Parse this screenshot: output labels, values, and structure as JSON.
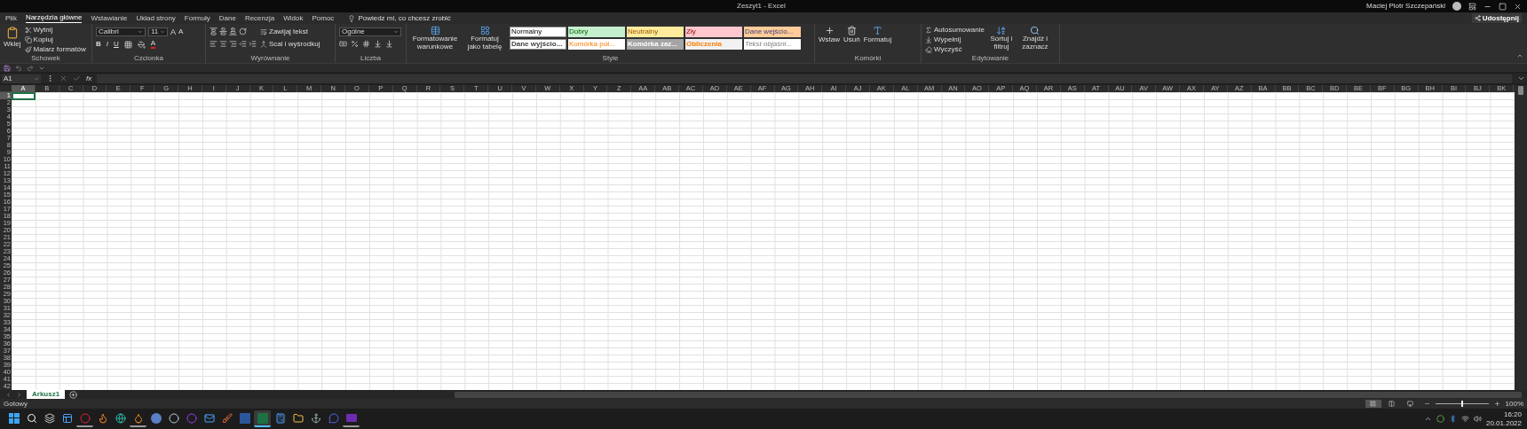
{
  "title_bar": {
    "title": "Zeszyt1 - Excel",
    "user": "Maciej Piotr Szczepański"
  },
  "tabs": [
    {
      "label": "Plik",
      "selected": false
    },
    {
      "label": "Narzędzia główne",
      "selected": true
    },
    {
      "label": "Wstawianie",
      "selected": false
    },
    {
      "label": "Układ strony",
      "selected": false
    },
    {
      "label": "Formuły",
      "selected": false
    },
    {
      "label": "Dane",
      "selected": false
    },
    {
      "label": "Recenzja",
      "selected": false
    },
    {
      "label": "Widok",
      "selected": false
    },
    {
      "label": "Pomoc",
      "selected": false
    }
  ],
  "tell_me": "Powiedz mi, co chcesz zrobić",
  "share_button": "Udostępnij",
  "ribbon": {
    "clipboard": {
      "label": "Schowek",
      "paste": "Wklej",
      "items": [
        "Wytnij",
        "Kopiuj",
        "Malarz formatów"
      ]
    },
    "font": {
      "label": "Czcionka",
      "font_name": "Calibri",
      "font_size": "11",
      "grow": "A",
      "shrink": "A",
      "bold": "B",
      "italic": "I",
      "underline": "U",
      "font_color": "A"
    },
    "alignment": {
      "label": "Wyrównanie",
      "wrap": "Zawijaj tekst",
      "merge": "Scal i wyśrodkuj"
    },
    "number": {
      "label": "Liczba",
      "format": "Ogólne"
    },
    "styles": {
      "label": "Style",
      "conditional": "Formatowanie warunkowe",
      "as_table": "Formatuj jako tabelę",
      "cells": [
        {
          "text": "Normalny",
          "kind": "normal"
        },
        {
          "text": "Dobry",
          "kind": "good"
        },
        {
          "text": "Neutralny",
          "kind": "neutral"
        },
        {
          "text": "Zły",
          "kind": "bad"
        },
        {
          "text": "Dane wejścio...",
          "kind": "input"
        },
        {
          "text": "Dane wyjścio...",
          "kind": "output"
        },
        {
          "text": "Komórka poł...",
          "kind": "linked"
        },
        {
          "text": "Komórka zaz...",
          "kind": "check"
        },
        {
          "text": "Obliczenia",
          "kind": "calculation"
        },
        {
          "text": "Tekst objaśni...",
          "kind": "explanatory"
        }
      ]
    },
    "cells": {
      "label": "Komórki",
      "buttons": [
        "Wstaw",
        "Usuń",
        "Formatuj"
      ]
    },
    "editing": {
      "label": "Edytowanie",
      "autosum": "Autosumowanie",
      "fill": "Wypełnij",
      "clear": "Wyczyść",
      "sort": "Sortuj i filtruj",
      "find": "Znajdź i zaznacz"
    }
  },
  "formula_bar": {
    "name_box": "A1",
    "function_label": "fx"
  },
  "columns": [
    {
      "label": "A",
      "selected": true
    },
    {
      "label": "B",
      "selected": false
    },
    {
      "label": "C",
      "selected": false
    },
    {
      "label": "D",
      "selected": false
    },
    {
      "label": "E",
      "selected": false
    },
    {
      "label": "F",
      "selected": false
    },
    {
      "label": "G",
      "selected": false
    },
    {
      "label": "H",
      "selected": false
    },
    {
      "label": "I",
      "selected": false
    },
    {
      "label": "J",
      "selected": false
    },
    {
      "label": "K",
      "selected": false
    },
    {
      "label": "L",
      "selected": false
    },
    {
      "label": "M",
      "selected": false
    },
    {
      "label": "N",
      "selected": false
    },
    {
      "label": "O",
      "selected": false
    },
    {
      "label": "P",
      "selected": false
    },
    {
      "label": "Q",
      "selected": false
    },
    {
      "label": "R",
      "selected": false
    },
    {
      "label": "S",
      "selected": false
    },
    {
      "label": "T",
      "selected": false
    },
    {
      "label": "U",
      "selected": false
    },
    {
      "label": "V",
      "selected": false
    },
    {
      "label": "W",
      "selected": false
    },
    {
      "label": "X",
      "selected": false
    },
    {
      "label": "Y",
      "selected": false
    },
    {
      "label": "Z",
      "selected": false
    },
    {
      "label": "AA",
      "selected": false
    },
    {
      "label": "AB",
      "selected": false
    },
    {
      "label": "AC",
      "selected": false
    },
    {
      "label": "AD",
      "selected": false
    },
    {
      "label": "AE",
      "selected": false
    },
    {
      "label": "AF",
      "selected": false
    },
    {
      "label": "AG",
      "selected": false
    },
    {
      "label": "AH",
      "selected": false
    },
    {
      "label": "AI",
      "selected": false
    },
    {
      "label": "AJ",
      "selected": false
    },
    {
      "label": "AK",
      "selected": false
    },
    {
      "label": "AL",
      "selected": false
    },
    {
      "label": "AM",
      "selected": false
    },
    {
      "label": "AN",
      "selected": false
    },
    {
      "label": "AO",
      "selected": false
    },
    {
      "label": "AP",
      "selected": false
    },
    {
      "label": "AQ",
      "selected": false
    },
    {
      "label": "AR",
      "selected": false
    },
    {
      "label": "AS",
      "selected": false
    },
    {
      "label": "AT",
      "selected": false
    },
    {
      "label": "AU",
      "selected": false
    },
    {
      "label": "AV",
      "selected": false
    },
    {
      "label": "AW",
      "selected": false
    },
    {
      "label": "AX",
      "selected": false
    },
    {
      "label": "AY",
      "selected": false
    },
    {
      "label": "AZ",
      "selected": false
    },
    {
      "label": "BA",
      "selected": false
    },
    {
      "label": "BB",
      "selected": false
    },
    {
      "label": "BC",
      "selected": false
    },
    {
      "label": "BD",
      "selected": false
    },
    {
      "label": "BE",
      "selected": false
    },
    {
      "label": "BF",
      "selected": false
    },
    {
      "label": "BG",
      "selected": false
    },
    {
      "label": "BH",
      "selected": false
    },
    {
      "label": "BI",
      "selected": false
    },
    {
      "label": "BJ",
      "selected": false
    },
    {
      "label": "BK",
      "selected": false
    }
  ],
  "rows": [
    {
      "label": "1",
      "selected": true
    },
    {
      "label": "2",
      "selected": false
    },
    {
      "label": "3",
      "selected": false
    },
    {
      "label": "4",
      "selected": false
    },
    {
      "label": "5",
      "selected": false
    },
    {
      "label": "6",
      "selected": false
    },
    {
      "label": "7",
      "selected": false
    },
    {
      "label": "8",
      "selected": false
    },
    {
      "label": "9",
      "selected": false
    },
    {
      "label": "10",
      "selected": false
    },
    {
      "label": "11",
      "selected": false
    },
    {
      "label": "12",
      "selected": false
    },
    {
      "label": "13",
      "selected": false
    },
    {
      "label": "14",
      "selected": false
    },
    {
      "label": "15",
      "selected": false
    },
    {
      "label": "16",
      "selected": false
    },
    {
      "label": "17",
      "selected": false
    },
    {
      "label": "18",
      "selected": false
    },
    {
      "label": "19",
      "selected": false
    },
    {
      "label": "20",
      "selected": false
    },
    {
      "label": "21",
      "selected": false
    },
    {
      "label": "22",
      "selected": false
    },
    {
      "label": "23",
      "selected": false
    },
    {
      "label": "24",
      "selected": false
    },
    {
      "label": "25",
      "selected": false
    },
    {
      "label": "26",
      "selected": false
    },
    {
      "label": "27",
      "selected": false
    },
    {
      "label": "28",
      "selected": false
    },
    {
      "label": "29",
      "selected": false
    },
    {
      "label": "30",
      "selected": false
    },
    {
      "label": "31",
      "selected": false
    },
    {
      "label": "32",
      "selected": false
    },
    {
      "label": "33",
      "selected": false
    },
    {
      "label": "34",
      "selected": false
    },
    {
      "label": "35",
      "selected": false
    },
    {
      "label": "36",
      "selected": false
    },
    {
      "label": "37",
      "selected": false
    },
    {
      "label": "38",
      "selected": false
    },
    {
      "label": "39",
      "selected": false
    },
    {
      "label": "40",
      "selected": false
    },
    {
      "label": "41",
      "selected": false
    },
    {
      "label": "42",
      "selected": false
    }
  ],
  "sheets": [
    {
      "label": "Arkusz1",
      "selected": true
    }
  ],
  "status_bar": {
    "status": "Gotowy",
    "views": [
      {
        "kind": "normal",
        "selected": true
      },
      {
        "kind": "layout",
        "selected": false
      },
      {
        "kind": "pagebreak",
        "selected": false
      }
    ],
    "zoom": {
      "level": 0.5,
      "reading": "100%"
    }
  },
  "taskbar": {
    "apps": [
      {
        "kind": "start",
        "running": false,
        "selected": false
      },
      {
        "kind": "search",
        "running": false,
        "selected": false
      },
      {
        "kind": "taskview",
        "running": false,
        "selected": false
      },
      {
        "kind": "widgets",
        "running": false,
        "selected": false
      },
      {
        "kind": "ring",
        "running": true,
        "selected": false
      },
      {
        "kind": "fox",
        "running": false,
        "selected": false
      },
      {
        "kind": "wave",
        "running": false,
        "selected": false
      },
      {
        "kind": "orange",
        "running": true,
        "selected": false
      },
      {
        "kind": "bluecircle",
        "running": false,
        "selected": false
      },
      {
        "kind": "lens",
        "running": false,
        "selected": false
      },
      {
        "kind": "purplering",
        "running": false,
        "selected": false
      },
      {
        "kind": "mail",
        "running": false,
        "selected": false
      },
      {
        "kind": "brush",
        "running": false,
        "selected": false
      },
      {
        "kind": "word",
        "running": false,
        "selected": false
      },
      {
        "kind": "excel",
        "running": true,
        "selected": true
      },
      {
        "kind": "calc",
        "running": false,
        "selected": false
      },
      {
        "kind": "folder",
        "running": false,
        "selected": false
      },
      {
        "kind": "anchor",
        "running": false,
        "selected": false
      },
      {
        "kind": "chat",
        "running": false,
        "selected": false
      },
      {
        "kind": "tile",
        "running": true,
        "selected": false
      }
    ],
    "time": "16:20",
    "date": "20.01.2022"
  }
}
